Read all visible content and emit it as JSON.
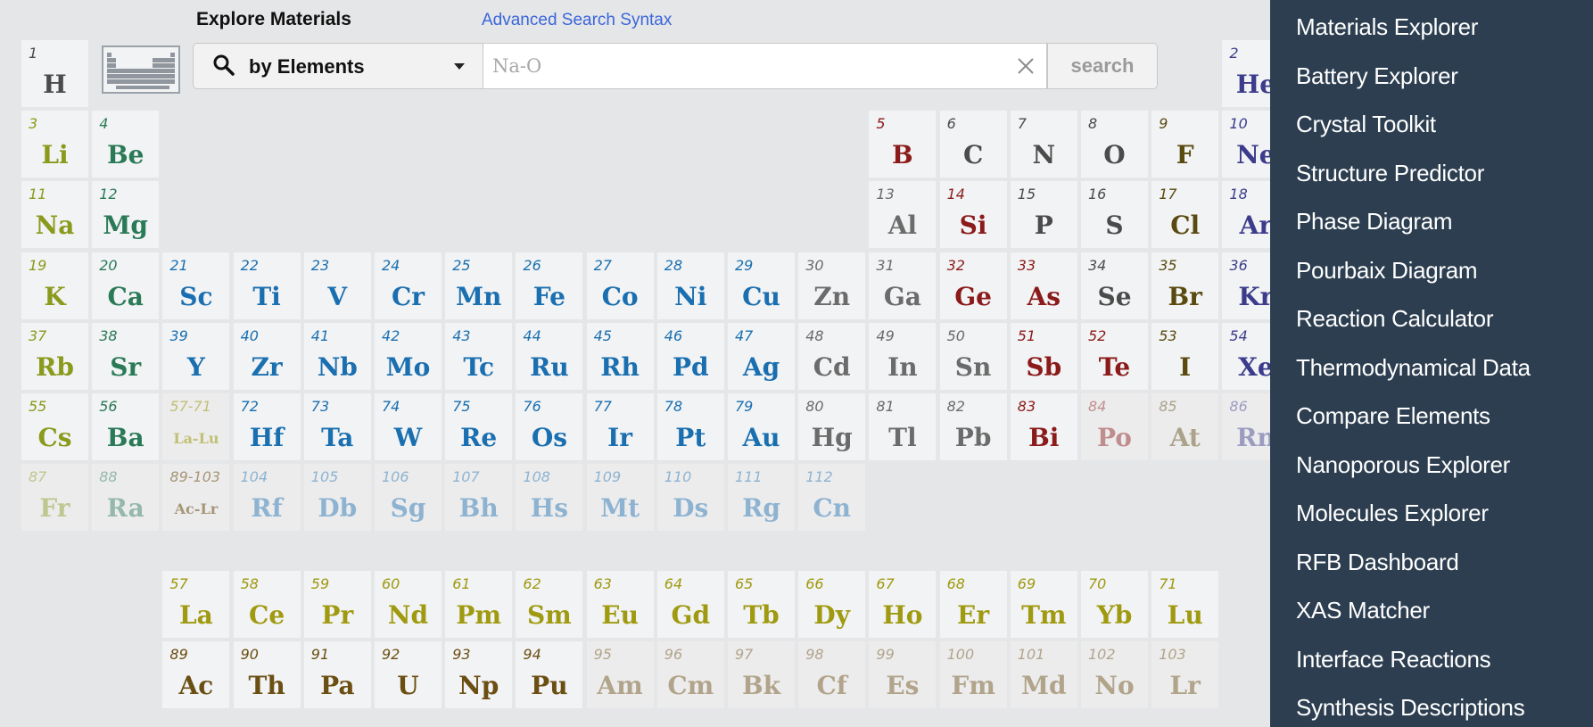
{
  "header": {
    "title": "Explore Materials",
    "advanced_link": "Advanced Search Syntax"
  },
  "search": {
    "mode_label": "by Elements",
    "placeholder": "Na-O",
    "button_label": "search"
  },
  "icons": {
    "search": "magnifier-icon",
    "dropdown": "chevron-down-icon",
    "clear": "close-icon",
    "table_thumb": "periodic-table-icon"
  },
  "colors": {
    "alkali": "#8a9a1c",
    "alkaline": "#2a7a58",
    "transition": "#1a6fb0",
    "post_transition": "#6b6b6b",
    "metalloid": "#8b1a1a",
    "nonmetal": "#4b4b4b",
    "halogen": "#5a4a10",
    "noble": "#3c3c8c",
    "lanthanide": "#9f9a10",
    "actinide": "#6b4e12",
    "sidebar_bg": "#2c3e50"
  },
  "elements": [
    {
      "n": "1",
      "s": "H",
      "col": 1,
      "row": 1,
      "c": "nonmetal"
    },
    {
      "n": "2",
      "s": "He",
      "col": 18,
      "row": 1,
      "c": "noble"
    },
    {
      "n": "3",
      "s": "Li",
      "col": 1,
      "row": 2,
      "c": "alkali"
    },
    {
      "n": "4",
      "s": "Be",
      "col": 2,
      "row": 2,
      "c": "alkaline"
    },
    {
      "n": "5",
      "s": "B",
      "col": 13,
      "row": 2,
      "c": "metalloid"
    },
    {
      "n": "6",
      "s": "C",
      "col": 14,
      "row": 2,
      "c": "nonmetal"
    },
    {
      "n": "7",
      "s": "N",
      "col": 15,
      "row": 2,
      "c": "nonmetal"
    },
    {
      "n": "8",
      "s": "O",
      "col": 16,
      "row": 2,
      "c": "nonmetal"
    },
    {
      "n": "9",
      "s": "F",
      "col": 17,
      "row": 2,
      "c": "halogen"
    },
    {
      "n": "10",
      "s": "Ne",
      "col": 18,
      "row": 2,
      "c": "noble"
    },
    {
      "n": "11",
      "s": "Na",
      "col": 1,
      "row": 3,
      "c": "alkali"
    },
    {
      "n": "12",
      "s": "Mg",
      "col": 2,
      "row": 3,
      "c": "alkaline"
    },
    {
      "n": "13",
      "s": "Al",
      "col": 13,
      "row": 3,
      "c": "post_transition"
    },
    {
      "n": "14",
      "s": "Si",
      "col": 14,
      "row": 3,
      "c": "metalloid"
    },
    {
      "n": "15",
      "s": "P",
      "col": 15,
      "row": 3,
      "c": "nonmetal"
    },
    {
      "n": "16",
      "s": "S",
      "col": 16,
      "row": 3,
      "c": "nonmetal"
    },
    {
      "n": "17",
      "s": "Cl",
      "col": 17,
      "row": 3,
      "c": "halogen"
    },
    {
      "n": "18",
      "s": "Ar",
      "col": 18,
      "row": 3,
      "c": "noble"
    },
    {
      "n": "19",
      "s": "K",
      "col": 1,
      "row": 4,
      "c": "alkali"
    },
    {
      "n": "20",
      "s": "Ca",
      "col": 2,
      "row": 4,
      "c": "alkaline"
    },
    {
      "n": "21",
      "s": "Sc",
      "col": 3,
      "row": 4,
      "c": "transition"
    },
    {
      "n": "22",
      "s": "Ti",
      "col": 4,
      "row": 4,
      "c": "transition"
    },
    {
      "n": "23",
      "s": "V",
      "col": 5,
      "row": 4,
      "c": "transition"
    },
    {
      "n": "24",
      "s": "Cr",
      "col": 6,
      "row": 4,
      "c": "transition"
    },
    {
      "n": "25",
      "s": "Mn",
      "col": 7,
      "row": 4,
      "c": "transition"
    },
    {
      "n": "26",
      "s": "Fe",
      "col": 8,
      "row": 4,
      "c": "transition"
    },
    {
      "n": "27",
      "s": "Co",
      "col": 9,
      "row": 4,
      "c": "transition"
    },
    {
      "n": "28",
      "s": "Ni",
      "col": 10,
      "row": 4,
      "c": "transition"
    },
    {
      "n": "29",
      "s": "Cu",
      "col": 11,
      "row": 4,
      "c": "transition"
    },
    {
      "n": "30",
      "s": "Zn",
      "col": 12,
      "row": 4,
      "c": "post_transition"
    },
    {
      "n": "31",
      "s": "Ga",
      "col": 13,
      "row": 4,
      "c": "post_transition"
    },
    {
      "n": "32",
      "s": "Ge",
      "col": 14,
      "row": 4,
      "c": "metalloid"
    },
    {
      "n": "33",
      "s": "As",
      "col": 15,
      "row": 4,
      "c": "metalloid"
    },
    {
      "n": "34",
      "s": "Se",
      "col": 16,
      "row": 4,
      "c": "nonmetal"
    },
    {
      "n": "35",
      "s": "Br",
      "col": 17,
      "row": 4,
      "c": "halogen"
    },
    {
      "n": "36",
      "s": "Kr",
      "col": 18,
      "row": 4,
      "c": "noble"
    },
    {
      "n": "37",
      "s": "Rb",
      "col": 1,
      "row": 5,
      "c": "alkali"
    },
    {
      "n": "38",
      "s": "Sr",
      "col": 2,
      "row": 5,
      "c": "alkaline"
    },
    {
      "n": "39",
      "s": "Y",
      "col": 3,
      "row": 5,
      "c": "transition"
    },
    {
      "n": "40",
      "s": "Zr",
      "col": 4,
      "row": 5,
      "c": "transition"
    },
    {
      "n": "41",
      "s": "Nb",
      "col": 5,
      "row": 5,
      "c": "transition"
    },
    {
      "n": "42",
      "s": "Mo",
      "col": 6,
      "row": 5,
      "c": "transition"
    },
    {
      "n": "43",
      "s": "Tc",
      "col": 7,
      "row": 5,
      "c": "transition"
    },
    {
      "n": "44",
      "s": "Ru",
      "col": 8,
      "row": 5,
      "c": "transition"
    },
    {
      "n": "45",
      "s": "Rh",
      "col": 9,
      "row": 5,
      "c": "transition"
    },
    {
      "n": "46",
      "s": "Pd",
      "col": 10,
      "row": 5,
      "c": "transition"
    },
    {
      "n": "47",
      "s": "Ag",
      "col": 11,
      "row": 5,
      "c": "transition"
    },
    {
      "n": "48",
      "s": "Cd",
      "col": 12,
      "row": 5,
      "c": "post_transition"
    },
    {
      "n": "49",
      "s": "In",
      "col": 13,
      "row": 5,
      "c": "post_transition"
    },
    {
      "n": "50",
      "s": "Sn",
      "col": 14,
      "row": 5,
      "c": "post_transition"
    },
    {
      "n": "51",
      "s": "Sb",
      "col": 15,
      "row": 5,
      "c": "metalloid"
    },
    {
      "n": "52",
      "s": "Te",
      "col": 16,
      "row": 5,
      "c": "metalloid"
    },
    {
      "n": "53",
      "s": "I",
      "col": 17,
      "row": 5,
      "c": "halogen"
    },
    {
      "n": "54",
      "s": "Xe",
      "col": 18,
      "row": 5,
      "c": "noble"
    },
    {
      "n": "55",
      "s": "Cs",
      "col": 1,
      "row": 6,
      "c": "alkali"
    },
    {
      "n": "56",
      "s": "Ba",
      "col": 2,
      "row": 6,
      "c": "alkaline"
    },
    {
      "n": "57-71",
      "s": "La-Lu",
      "col": 3,
      "row": 6,
      "c": "lanthanide",
      "small": true,
      "dim": true
    },
    {
      "n": "72",
      "s": "Hf",
      "col": 4,
      "row": 6,
      "c": "transition"
    },
    {
      "n": "73",
      "s": "Ta",
      "col": 5,
      "row": 6,
      "c": "transition"
    },
    {
      "n": "74",
      "s": "W",
      "col": 6,
      "row": 6,
      "c": "transition"
    },
    {
      "n": "75",
      "s": "Re",
      "col": 7,
      "row": 6,
      "c": "transition"
    },
    {
      "n": "76",
      "s": "Os",
      "col": 8,
      "row": 6,
      "c": "transition"
    },
    {
      "n": "77",
      "s": "Ir",
      "col": 9,
      "row": 6,
      "c": "transition"
    },
    {
      "n": "78",
      "s": "Pt",
      "col": 10,
      "row": 6,
      "c": "transition"
    },
    {
      "n": "79",
      "s": "Au",
      "col": 11,
      "row": 6,
      "c": "transition"
    },
    {
      "n": "80",
      "s": "Hg",
      "col": 12,
      "row": 6,
      "c": "post_transition"
    },
    {
      "n": "81",
      "s": "Tl",
      "col": 13,
      "row": 6,
      "c": "post_transition"
    },
    {
      "n": "82",
      "s": "Pb",
      "col": 14,
      "row": 6,
      "c": "post_transition"
    },
    {
      "n": "83",
      "s": "Bi",
      "col": 15,
      "row": 6,
      "c": "metalloid"
    },
    {
      "n": "84",
      "s": "Po",
      "col": 16,
      "row": 6,
      "c": "metalloid",
      "dim": true
    },
    {
      "n": "85",
      "s": "At",
      "col": 17,
      "row": 6,
      "c": "halogen",
      "dim": true
    },
    {
      "n": "86",
      "s": "Rn",
      "col": 18,
      "row": 6,
      "c": "noble",
      "dim": true
    },
    {
      "n": "87",
      "s": "Fr",
      "col": 1,
      "row": 7,
      "c": "alkali",
      "dim": true
    },
    {
      "n": "88",
      "s": "Ra",
      "col": 2,
      "row": 7,
      "c": "alkaline",
      "dim": true
    },
    {
      "n": "89-103",
      "s": "Ac-Lr",
      "col": 3,
      "row": 7,
      "c": "actinide",
      "small": true,
      "dim": true
    },
    {
      "n": "104",
      "s": "Rf",
      "col": 4,
      "row": 7,
      "c": "transition",
      "dim": true
    },
    {
      "n": "105",
      "s": "Db",
      "col": 5,
      "row": 7,
      "c": "transition",
      "dim": true
    },
    {
      "n": "106",
      "s": "Sg",
      "col": 6,
      "row": 7,
      "c": "transition",
      "dim": true
    },
    {
      "n": "107",
      "s": "Bh",
      "col": 7,
      "row": 7,
      "c": "transition",
      "dim": true
    },
    {
      "n": "108",
      "s": "Hs",
      "col": 8,
      "row": 7,
      "c": "transition",
      "dim": true
    },
    {
      "n": "109",
      "s": "Mt",
      "col": 9,
      "row": 7,
      "c": "transition",
      "dim": true
    },
    {
      "n": "110",
      "s": "Ds",
      "col": 10,
      "row": 7,
      "c": "transition",
      "dim": true
    },
    {
      "n": "111",
      "s": "Rg",
      "col": 11,
      "row": 7,
      "c": "transition",
      "dim": true
    },
    {
      "n": "112",
      "s": "Cn",
      "col": 12,
      "row": 7,
      "c": "transition",
      "dim": true
    },
    {
      "n": "57",
      "s": "La",
      "col": 3,
      "row": 8,
      "c": "lanthanide"
    },
    {
      "n": "58",
      "s": "Ce",
      "col": 4,
      "row": 8,
      "c": "lanthanide"
    },
    {
      "n": "59",
      "s": "Pr",
      "col": 5,
      "row": 8,
      "c": "lanthanide"
    },
    {
      "n": "60",
      "s": "Nd",
      "col": 6,
      "row": 8,
      "c": "lanthanide"
    },
    {
      "n": "61",
      "s": "Pm",
      "col": 7,
      "row": 8,
      "c": "lanthanide"
    },
    {
      "n": "62",
      "s": "Sm",
      "col": 8,
      "row": 8,
      "c": "lanthanide"
    },
    {
      "n": "63",
      "s": "Eu",
      "col": 9,
      "row": 8,
      "c": "lanthanide"
    },
    {
      "n": "64",
      "s": "Gd",
      "col": 10,
      "row": 8,
      "c": "lanthanide"
    },
    {
      "n": "65",
      "s": "Tb",
      "col": 11,
      "row": 8,
      "c": "lanthanide"
    },
    {
      "n": "66",
      "s": "Dy",
      "col": 12,
      "row": 8,
      "c": "lanthanide"
    },
    {
      "n": "67",
      "s": "Ho",
      "col": 13,
      "row": 8,
      "c": "lanthanide"
    },
    {
      "n": "68",
      "s": "Er",
      "col": 14,
      "row": 8,
      "c": "lanthanide"
    },
    {
      "n": "69",
      "s": "Tm",
      "col": 15,
      "row": 8,
      "c": "lanthanide"
    },
    {
      "n": "70",
      "s": "Yb",
      "col": 16,
      "row": 8,
      "c": "lanthanide"
    },
    {
      "n": "71",
      "s": "Lu",
      "col": 17,
      "row": 8,
      "c": "lanthanide"
    },
    {
      "n": "89",
      "s": "Ac",
      "col": 3,
      "row": 9,
      "c": "actinide"
    },
    {
      "n": "90",
      "s": "Th",
      "col": 4,
      "row": 9,
      "c": "actinide"
    },
    {
      "n": "91",
      "s": "Pa",
      "col": 5,
      "row": 9,
      "c": "actinide"
    },
    {
      "n": "92",
      "s": "U",
      "col": 6,
      "row": 9,
      "c": "actinide"
    },
    {
      "n": "93",
      "s": "Np",
      "col": 7,
      "row": 9,
      "c": "actinide"
    },
    {
      "n": "94",
      "s": "Pu",
      "col": 8,
      "row": 9,
      "c": "actinide"
    },
    {
      "n": "95",
      "s": "Am",
      "col": 9,
      "row": 9,
      "c": "actinide",
      "dim": true
    },
    {
      "n": "96",
      "s": "Cm",
      "col": 10,
      "row": 9,
      "c": "actinide",
      "dim": true
    },
    {
      "n": "97",
      "s": "Bk",
      "col": 11,
      "row": 9,
      "c": "actinide",
      "dim": true
    },
    {
      "n": "98",
      "s": "Cf",
      "col": 12,
      "row": 9,
      "c": "actinide",
      "dim": true
    },
    {
      "n": "99",
      "s": "Es",
      "col": 13,
      "row": 9,
      "c": "actinide",
      "dim": true
    },
    {
      "n": "100",
      "s": "Fm",
      "col": 14,
      "row": 9,
      "c": "actinide",
      "dim": true
    },
    {
      "n": "101",
      "s": "Md",
      "col": 15,
      "row": 9,
      "c": "actinide",
      "dim": true
    },
    {
      "n": "102",
      "s": "No",
      "col": 16,
      "row": 9,
      "c": "actinide",
      "dim": true
    },
    {
      "n": "103",
      "s": "Lr",
      "col": 17,
      "row": 9,
      "c": "actinide",
      "dim": true
    }
  ],
  "sidebar": {
    "items": [
      {
        "label": "Materials Explorer"
      },
      {
        "label": "Battery Explorer"
      },
      {
        "label": "Crystal Toolkit"
      },
      {
        "label": "Structure Predictor"
      },
      {
        "label": "Phase Diagram"
      },
      {
        "label": "Pourbaix Diagram"
      },
      {
        "label": "Reaction Calculator"
      },
      {
        "label": "Thermodynamical Data"
      },
      {
        "label": "Compare Elements"
      },
      {
        "label": "Nanoporous Explorer"
      },
      {
        "label": "Molecules Explorer"
      },
      {
        "label": "RFB Dashboard"
      },
      {
        "label": "XAS Matcher"
      },
      {
        "label": "Interface Reactions"
      },
      {
        "label": "Synthesis Descriptions"
      }
    ]
  }
}
